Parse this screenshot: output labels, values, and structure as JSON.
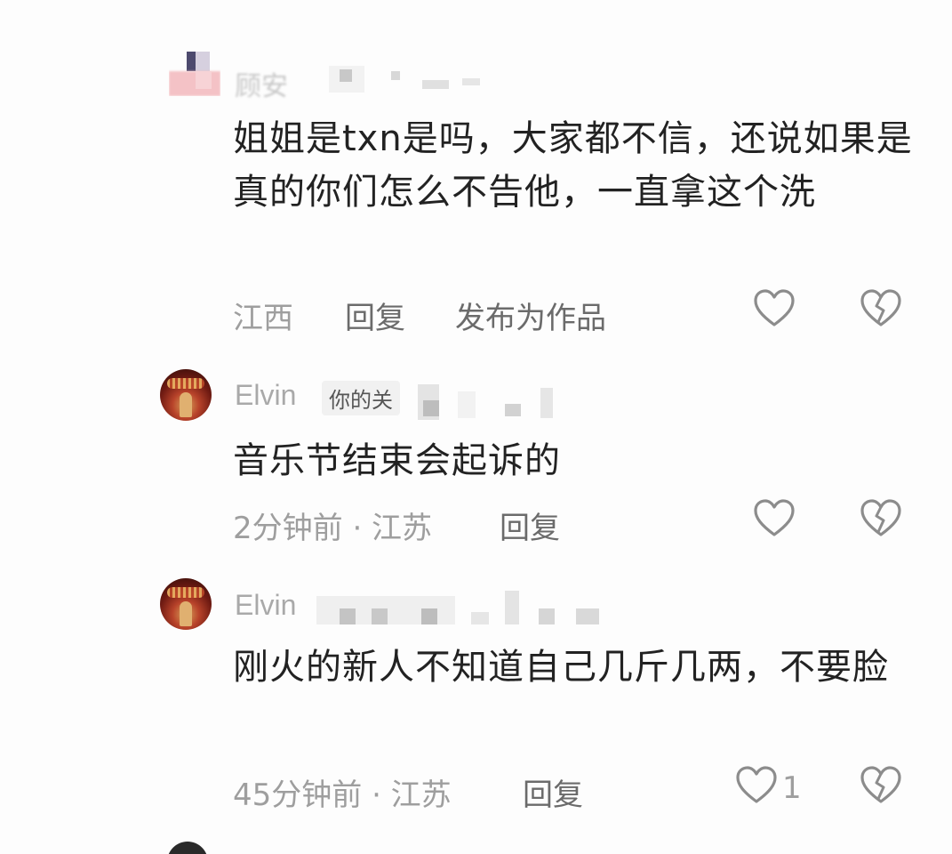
{
  "comments": [
    {
      "username": "顾安",
      "text": "姐姐是txn是吗，大家都不信，还说如果是真的你们怎么不告他，一直拿这个洗",
      "location": "江西",
      "reply_label": "回复",
      "publish_label": "发布为作品"
    },
    {
      "username": "Elvin",
      "tag": "你的关",
      "text": "音乐节结束会起诉的",
      "time_location": "2分钟前 · 江苏",
      "reply_label": "回复"
    },
    {
      "username": "Elvin",
      "text": "刚火的新人不知道自己几斤几两，不要脸",
      "time_location": "45分钟前 · 江苏",
      "reply_label": "回复",
      "like_count": "1"
    }
  ],
  "icons": {
    "like": "heart-outline-icon",
    "dislike": "broken-heart-icon"
  },
  "colors": {
    "text": "#222222",
    "meta": "#9e9e9e",
    "action": "#6b6b6b",
    "icon": "#8c8c8c"
  }
}
